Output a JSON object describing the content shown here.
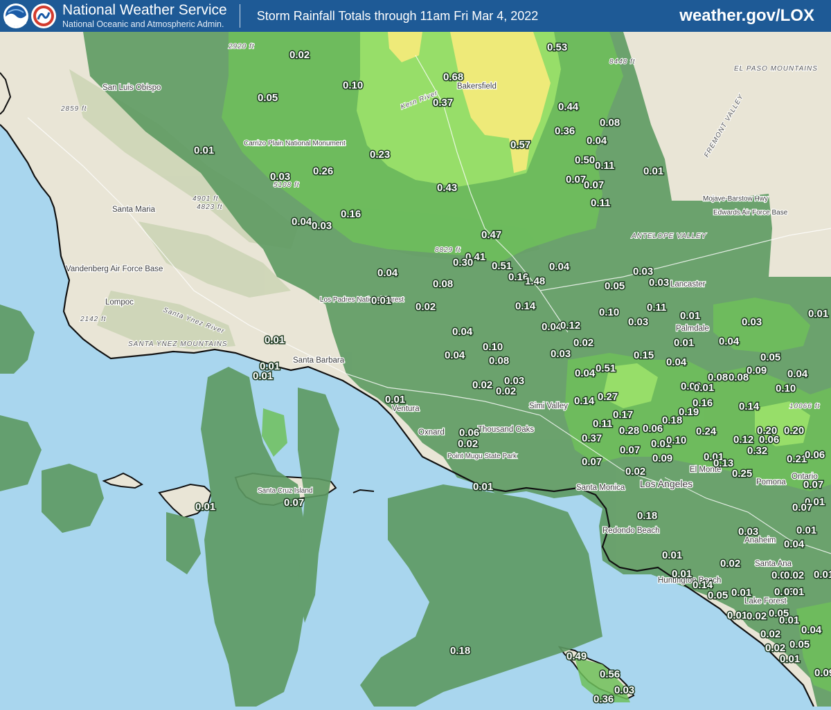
{
  "header": {
    "org_title": "National Weather Service",
    "org_subtitle": "National Oceanic and Atmospheric Admin.",
    "map_title": "Storm Rainfall Totals through 11am Fri Mar 4, 2022",
    "site": "weather.gov/LOX",
    "noaa_logo_icon": "noaa-logo-icon",
    "nws_logo_icon": "nws-logo-icon",
    "colors": {
      "header_bg": "#1e5a96",
      "ocean": "#a9d6ee",
      "land": "#ece8d9",
      "precip_low": "#5d9a62",
      "precip_mid": "#6fbf5a",
      "precip_high": "#9be26a",
      "precip_peak": "#f2ea7a"
    }
  },
  "map": {
    "places": {
      "san_luis_obispo": "San Luis Obispo",
      "santa_maria": "Santa Maria",
      "vandenberg": "Vandenberg Air Force Base",
      "lompoc": "Lompoc",
      "santa_barbara": "Santa Barbara",
      "ventura": "Ventura",
      "oxnard": "Oxnard",
      "thousand_oaks": "Thousand Oaks",
      "simi_valley": "Simi Valley",
      "santa_monica": "Santa Monica",
      "los_angeles": "Los Angeles",
      "el_monte": "El Monte",
      "pomona": "Pomona",
      "ontario": "Ontario",
      "redondo_beach": "Redondo Beach",
      "anaheim": "Anaheim",
      "santa_ana": "Santa Ana",
      "huntington_beach": "Huntington Beach",
      "lake_forest": "Lake Forest",
      "bakersfield": "Bakersfield",
      "lancaster": "Lancaster",
      "palmdale": "Palmdale",
      "edwards": "Edwards Air Force Base",
      "carrizo": "Carrizo Plain National Monument",
      "los_padres": "Los Padres National Forest",
      "point_mugu": "Point Mugu State Park",
      "antelope_valley": "ANTELOPE VALLEY",
      "el_paso_mtns": "EL PASO MOUNTAINS",
      "fremont_valley": "FREMONT VALLEY",
      "santa_ynez": "SANTA YNEZ MOUNTAINS",
      "mojave_hwy": "Mojave-Barstow Hwy",
      "santa_cruz_island": "Santa Cruz Island",
      "kern_river": "Kern River",
      "santa_ynez_river": "Santa Ynez River"
    },
    "elevations": {
      "e2920": "2920 ft",
      "e2859": "2859 ft",
      "e4901": "4901 ft",
      "e4823": "4823 ft",
      "e5108": "5108 ft",
      "e2142": "2142 ft",
      "e8448": "8448 ft",
      "e8829": "8829 ft",
      "e10066": "10066 ft"
    },
    "rainfall": [
      {
        "v": "0.02"
      },
      {
        "v": "0.10"
      },
      {
        "v": "0.05"
      },
      {
        "v": "0.01"
      },
      {
        "v": "0.03"
      },
      {
        "v": "0.26"
      },
      {
        "v": "0.23"
      },
      {
        "v": "0.16"
      },
      {
        "v": "0.04"
      },
      {
        "v": "0.03"
      },
      {
        "v": "0.68"
      },
      {
        "v": "0.37"
      },
      {
        "v": "0.43"
      },
      {
        "v": "0.57"
      },
      {
        "v": "0.53"
      },
      {
        "v": "0.44"
      },
      {
        "v": "0.36"
      },
      {
        "v": "0.08"
      },
      {
        "v": "0.04"
      },
      {
        "v": "0.50"
      },
      {
        "v": "0.11"
      },
      {
        "v": "0.07"
      },
      {
        "v": "0.07"
      },
      {
        "v": "0.11"
      },
      {
        "v": "0.01"
      },
      {
        "v": "0.47"
      },
      {
        "v": "0.41"
      },
      {
        "v": "0.30"
      },
      {
        "v": "0.51"
      },
      {
        "v": "0.16"
      },
      {
        "v": "1.48"
      },
      {
        "v": "0.04"
      },
      {
        "v": "0.04"
      },
      {
        "v": "0.08"
      },
      {
        "v": "0.01"
      },
      {
        "v": "0.02"
      },
      {
        "v": "0.14"
      },
      {
        "v": "0.05"
      },
      {
        "v": "0.03"
      },
      {
        "v": "0.03"
      },
      {
        "v": "0.10"
      },
      {
        "v": "0.03"
      },
      {
        "v": "0.11"
      },
      {
        "v": "0.01"
      },
      {
        "v": "0.01"
      },
      {
        "v": "0.03"
      },
      {
        "v": "0.04"
      },
      {
        "v": "0.12"
      },
      {
        "v": "0.04"
      },
      {
        "v": "0.10"
      },
      {
        "v": "0.08"
      },
      {
        "v": "0.04"
      },
      {
        "v": "0.02"
      },
      {
        "v": "0.03"
      },
      {
        "v": "0.04"
      },
      {
        "v": "0.51"
      },
      {
        "v": "0.02"
      },
      {
        "v": "0.03"
      },
      {
        "v": "0.02"
      },
      {
        "v": "0.01"
      },
      {
        "v": "0.01"
      },
      {
        "v": "0.01"
      },
      {
        "v": "0.01"
      },
      {
        "v": "0.06"
      },
      {
        "v": "0.02"
      },
      {
        "v": "0.14"
      },
      {
        "v": "0.27"
      },
      {
        "v": "0.17"
      },
      {
        "v": "0.11"
      },
      {
        "v": "0.37"
      },
      {
        "v": "0.07"
      },
      {
        "v": "0.28"
      },
      {
        "v": "0.06"
      },
      {
        "v": "0.07"
      },
      {
        "v": "0.02"
      },
      {
        "v": "0.01"
      },
      {
        "v": "0.10"
      },
      {
        "v": "0.09"
      },
      {
        "v": "0.18"
      },
      {
        "v": "0.19"
      },
      {
        "v": "0.24"
      },
      {
        "v": "0.16"
      },
      {
        "v": "0.03"
      },
      {
        "v": "0.15"
      },
      {
        "v": "0.04"
      },
      {
        "v": "0.01"
      },
      {
        "v": "0.04"
      },
      {
        "v": "0.05"
      },
      {
        "v": "0.08"
      },
      {
        "v": "0.08"
      },
      {
        "v": "0.09"
      },
      {
        "v": "0.10"
      },
      {
        "v": "0.04"
      },
      {
        "v": "0.14"
      },
      {
        "v": "0.20"
      },
      {
        "v": "0.12"
      },
      {
        "v": "0.06"
      },
      {
        "v": "0.32"
      },
      {
        "v": "0.20"
      },
      {
        "v": "0.21"
      },
      {
        "v": "0.06"
      },
      {
        "v": "0.01"
      },
      {
        "v": "0.13"
      },
      {
        "v": "0.25"
      },
      {
        "v": "0.07"
      },
      {
        "v": "0.01"
      },
      {
        "v": "0.07"
      },
      {
        "v": "0.18"
      },
      {
        "v": "0.01"
      },
      {
        "v": "0.03"
      },
      {
        "v": "0.04"
      },
      {
        "v": "0.01"
      },
      {
        "v": "0.01"
      },
      {
        "v": "0.14"
      },
      {
        "v": "0.05"
      },
      {
        "v": "0.01"
      },
      {
        "v": "0.02"
      },
      {
        "v": "0.01"
      },
      {
        "v": "0.02"
      },
      {
        "v": "0.03"
      },
      {
        "v": "0.01"
      },
      {
        "v": "0.01"
      },
      {
        "v": "0.02"
      },
      {
        "v": "0.05"
      },
      {
        "v": "0.01"
      },
      {
        "v": "0.02"
      },
      {
        "v": "0.04"
      },
      {
        "v": "0.02"
      },
      {
        "v": "0.05"
      },
      {
        "v": "0.01"
      },
      {
        "v": "0.01"
      },
      {
        "v": "0.09"
      },
      {
        "v": "0.07"
      },
      {
        "v": "0.18"
      },
      {
        "v": "0.49"
      },
      {
        "v": "0.56"
      },
      {
        "v": "0.36"
      },
      {
        "v": "0.03"
      },
      {
        "v": "0.01"
      }
    ]
  }
}
